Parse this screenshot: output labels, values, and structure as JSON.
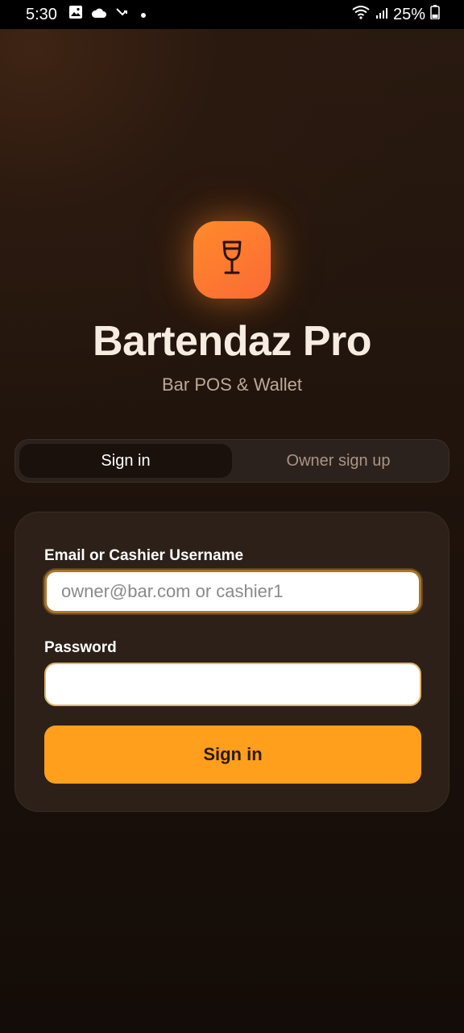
{
  "status_bar": {
    "time": "5:30",
    "battery_percent": "25%",
    "icons": [
      "gallery-icon",
      "cloud-icon",
      "missed-call-icon",
      "dot-icon",
      "wifi-icon",
      "signal-icon",
      "battery-icon"
    ]
  },
  "app": {
    "logo_icon": "wine-glass-icon",
    "title": "Bartendaz Pro",
    "subtitle": "Bar POS & Wallet"
  },
  "tabs": [
    {
      "label": "Sign in",
      "active": true
    },
    {
      "label": "Owner sign up",
      "active": false
    }
  ],
  "form": {
    "email_label": "Email or Cashier Username",
    "email_placeholder": "owner@bar.com or cashier1",
    "email_value": "",
    "password_label": "Password",
    "password_value": "",
    "submit_label": "Sign in"
  },
  "colors": {
    "accent": "#ff9f1c",
    "logo_gradient_start": "#ff8a2a",
    "logo_gradient_end": "#fb6a36",
    "background": "#1d120b"
  }
}
